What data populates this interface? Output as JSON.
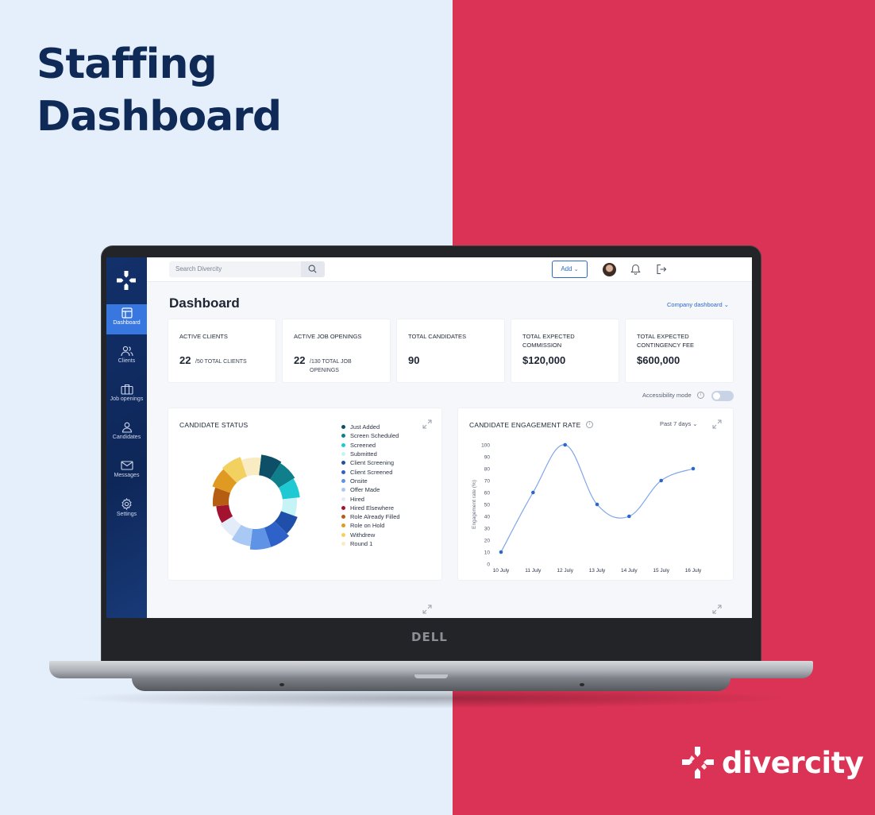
{
  "headline": {
    "line1": "Staffing",
    "line2": "Dashboard"
  },
  "brand": {
    "name": "divercity"
  },
  "laptop": {
    "logo": "DELL"
  },
  "sidebar": {
    "items": [
      {
        "label": "Dashboard",
        "icon": "layout-icon",
        "active": true
      },
      {
        "label": "Clients",
        "icon": "users-icon"
      },
      {
        "label": "Job openings",
        "icon": "briefcase-icon"
      },
      {
        "label": "Candidates",
        "icon": "user-icon"
      },
      {
        "label": "Messages",
        "icon": "mail-icon"
      },
      {
        "label": "Settings",
        "icon": "gear-icon"
      }
    ]
  },
  "topbar": {
    "search_placeholder": "Search Divercity",
    "add_label": "Add"
  },
  "page": {
    "title": "Dashboard",
    "company_dropdown": "Company dashboard"
  },
  "kpis": [
    {
      "label": "ACTIVE CLIENTS",
      "value": "22",
      "sub": "/50 TOTAL CLIENTS"
    },
    {
      "label": "ACTIVE JOB OPENINGS",
      "value": "22",
      "sub": "/130 TOTAL JOB OPENINGS"
    },
    {
      "label": "TOTAL CANDIDATES",
      "value": "90",
      "sub": ""
    },
    {
      "label": "TOTAL EXPECTED COMMISSION",
      "value": "$120,000",
      "sub": ""
    },
    {
      "label": "TOTAL EXPECTED CONTINGENCY FEE",
      "value": "$600,000",
      "sub": ""
    }
  ],
  "accessibility": {
    "label": "Accessibility mode",
    "enabled": false
  },
  "candidate_status": {
    "title": "CANDIDATE STATUS",
    "legend": [
      {
        "name": "Just Added",
        "color": "#0d4f66"
      },
      {
        "name": "Screen Scheduled",
        "color": "#0f7f8c"
      },
      {
        "name": "Screened",
        "color": "#1ec9d4"
      },
      {
        "name": "Submitted",
        "color": "#c6f3f5"
      },
      {
        "name": "Client Screening",
        "color": "#1f4fa8"
      },
      {
        "name": "Client Screened",
        "color": "#2f62c9"
      },
      {
        "name": "Onsite",
        "color": "#5f93e6"
      },
      {
        "name": "Offer Made",
        "color": "#a9c9f5"
      },
      {
        "name": "Hired",
        "color": "#e3ecf8"
      },
      {
        "name": "Hired Elsewhere",
        "color": "#a3122f"
      },
      {
        "name": "Role Already Filled",
        "color": "#b55d12"
      },
      {
        "name": "Role on Hold",
        "color": "#e09a21"
      },
      {
        "name": "Withdrew",
        "color": "#f3d160"
      },
      {
        "name": "Round 1",
        "color": "#faecc2"
      }
    ]
  },
  "chart_data": {
    "type": "line",
    "title": "CANDIDATE ENGAGEMENT RATE",
    "period": "Past 7 days",
    "x": [
      "10 July",
      "11 July",
      "12 July",
      "13 July",
      "14 July",
      "15 July",
      "16 July"
    ],
    "values": [
      10,
      60,
      100,
      50,
      40,
      70,
      80
    ],
    "ylabel": "Engagement rate (%)",
    "ylim": [
      0,
      100
    ],
    "yticks": [
      0,
      10,
      20,
      30,
      40,
      50,
      60,
      70,
      80,
      90,
      100
    ],
    "line_color": "#7fa6ec",
    "point_color": "#2f67c9"
  }
}
